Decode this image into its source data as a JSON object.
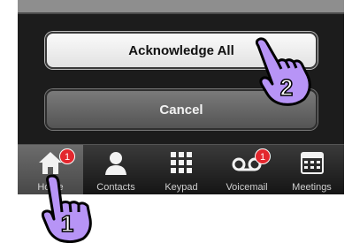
{
  "dialog": {
    "acknowledge_label": "Acknowledge All",
    "cancel_label": "Cancel"
  },
  "tabbar": {
    "tabs": [
      {
        "label": "Home",
        "icon": "home-icon",
        "badge": "1",
        "selected": true
      },
      {
        "label": "Contacts",
        "icon": "contact-icon"
      },
      {
        "label": "Keypad",
        "icon": "keypad-icon"
      },
      {
        "label": "Voicemail",
        "icon": "voicemail-icon",
        "badge": "1"
      },
      {
        "label": "Meetings",
        "icon": "calendar-icon"
      }
    ]
  },
  "annotations": {
    "step_1": "1",
    "step_2": "2"
  },
  "colors": {
    "badge": "#e3272e",
    "pointer_hand": "#b794f6"
  }
}
